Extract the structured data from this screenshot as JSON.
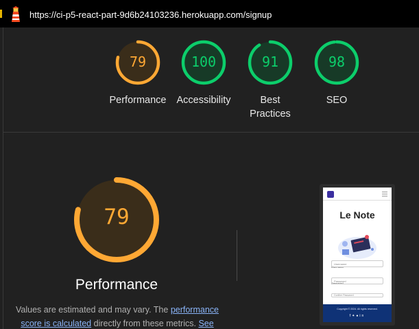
{
  "browser": {
    "url": "https://ci-p5-react-part-9d6b24103236.herokuapp.com/signup",
    "logo_icon": "lighthouse-icon"
  },
  "summary_gauges": [
    {
      "label": "Performance",
      "score": "79",
      "color": "#ffa834",
      "fill": 0.79
    },
    {
      "label": "Accessibility",
      "score": "100",
      "color": "#0cce6b",
      "fill": 1.0
    },
    {
      "label": "Best Practices",
      "score": "91",
      "color": "#0cce6b",
      "fill": 0.91
    },
    {
      "label": "SEO",
      "score": "98",
      "color": "#0cce6b",
      "fill": 0.98
    }
  ],
  "performance": {
    "score": "79",
    "fill": 0.79,
    "color": "#ffa834",
    "title": "Performance",
    "desc_prefix": "Values are estimated and may vary. The ",
    "desc_link1": "performance score is calculated",
    "desc_middle": " directly from these metrics. ",
    "desc_link2": "See"
  },
  "screenshot": {
    "app_title": "Le Note",
    "username_label": "Username",
    "username_placeholder": "Username",
    "password_label": "Password",
    "password_placeholder": "Password",
    "confirm_placeholder": "Confirm Password",
    "footer_copyright": "Copyright © 2024. All rights reserved.",
    "social_icons": [
      "facebook-icon",
      "twitter-icon",
      "github-icon",
      "linkedin-icon"
    ]
  },
  "colors": {
    "pass": "#0cce6b",
    "average": "#ffa834",
    "background": "#212121"
  }
}
